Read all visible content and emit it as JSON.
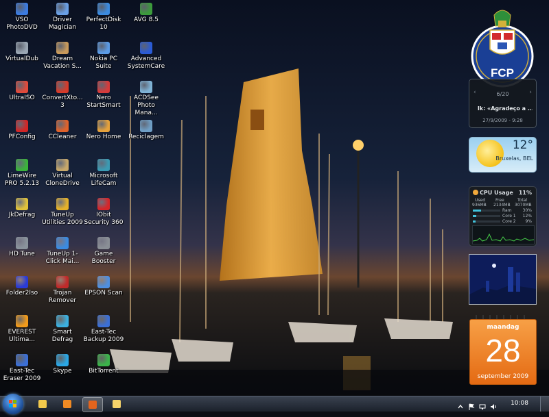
{
  "desktop": {
    "icons": [
      {
        "label": "VSO PhotoDVD",
        "icon": "vso-photodvd-icon",
        "color": "#3b7be0"
      },
      {
        "label": "VirtualDub",
        "icon": "virtualdub-icon",
        "color": "#9aa6b3"
      },
      {
        "label": "UltraISO",
        "icon": "ultraiso-icon",
        "color": "#e04a3b"
      },
      {
        "label": "PFConfig",
        "icon": "pfconfig-icon",
        "color": "#d22626"
      },
      {
        "label": "LimeWire PRO 5.2.13",
        "icon": "limewire-icon",
        "color": "#3bb33b"
      },
      {
        "label": "JkDefrag",
        "icon": "jkdefrag-icon",
        "color": "#e0c23b"
      },
      {
        "label": "HD Tune",
        "icon": "hdtune-icon",
        "color": "#8a939c"
      },
      {
        "label": "Folder2Iso",
        "icon": "folder2iso-icon",
        "color": "#2a3bd6"
      },
      {
        "label": "EVEREST Ultima...",
        "icon": "everest-icon",
        "color": "#f09a1b"
      },
      {
        "label": "East-Tec Eraser 2009",
        "icon": "east-tec-eraser-icon",
        "color": "#3b6fd6"
      },
      {
        "label": "Driver Magician",
        "icon": "driver-magician-icon",
        "color": "#6aa0e6"
      },
      {
        "label": "Dream Vacation S...",
        "icon": "dream-vacation-icon",
        "color": "#c99a5b"
      },
      {
        "label": "ConvertXto... 3",
        "icon": "convertxtodvd-icon",
        "color": "#d63b2a"
      },
      {
        "label": "CCleaner",
        "icon": "ccleaner-icon",
        "color": "#e0622a"
      },
      {
        "label": "Virtual CloneDrive",
        "icon": "virtual-clonedrive-icon",
        "color": "#c7a86a"
      },
      {
        "label": "TuneUp Utilities 2009",
        "icon": "tuneup-utilities-icon",
        "color": "#e6b22a"
      },
      {
        "label": "TuneUp 1-Click Mai...",
        "icon": "tuneup-1click-icon",
        "color": "#3b8be0"
      },
      {
        "label": "Trojan Remover",
        "icon": "trojan-remover-icon",
        "color": "#c02a2a"
      },
      {
        "label": "Smart Defrag",
        "icon": "smart-defrag-icon",
        "color": "#3bb0e0"
      },
      {
        "label": "Skype",
        "icon": "skype-icon",
        "color": "#2aa7e6"
      },
      {
        "label": "PerfectDisk 10",
        "icon": "perfectdisk-icon",
        "color": "#3b8be0"
      },
      {
        "label": "Nokia PC Suite",
        "icon": "nokia-pc-suite-icon",
        "color": "#5b9be6"
      },
      {
        "label": "Nero StartSmart",
        "icon": "nero-startsmart-icon",
        "color": "#d63b3b"
      },
      {
        "label": "Nero Home",
        "icon": "nero-home-icon",
        "color": "#e6a23b"
      },
      {
        "label": "Microsoft LifeCam",
        "icon": "lifecam-icon",
        "color": "#3b9bb3"
      },
      {
        "label": "IObit Security 360",
        "icon": "iobit-security-icon",
        "color": "#d6262a"
      },
      {
        "label": "Game Booster",
        "icon": "game-booster-icon",
        "color": "#8a8f96"
      },
      {
        "label": "EPSON Scan",
        "icon": "epson-scan-icon",
        "color": "#4f8fe0"
      },
      {
        "label": "East-Tec Backup 2009",
        "icon": "east-tec-backup-icon",
        "color": "#3b6fd6"
      },
      {
        "label": "BitTorrent",
        "icon": "bittorrent-icon",
        "color": "#3bb34a"
      },
      {
        "label": "AVG 8.5",
        "icon": "avg-icon",
        "color": "#3b9b3b"
      },
      {
        "label": "Advanced SystemCare",
        "icon": "advanced-systemcare-icon",
        "color": "#2a5bd6"
      },
      {
        "label": "ACDSee Photo Mana...",
        "icon": "acdsee-icon",
        "color": "#7fb3d6"
      },
      {
        "label": "Reciclagem",
        "icon": "recycle-bin-icon",
        "color": "#6f9fc6"
      }
    ]
  },
  "gadgets": {
    "logo": {
      "icon": "fc-porto-crest-icon",
      "text": "FCP"
    },
    "slideshow": {
      "counter": "6/20",
      "title": "lk: «Agradeço a ...",
      "datetime": "27/9/2009 - 9:28"
    },
    "weather": {
      "temperature": "12°",
      "location": "Bruxelas, BEL"
    },
    "cpu": {
      "title": "CPU Usage",
      "percent": "11%",
      "used_label": "Used",
      "free_label": "Free",
      "total_label": "Total",
      "used": "936MB",
      "free": "2134MB",
      "total": "3070MB",
      "rows": [
        {
          "label": "Ram",
          "value": "30%",
          "fill": 0.3
        },
        {
          "label": "Core 1",
          "value": "12%",
          "fill": 0.12
        },
        {
          "label": "Core 2",
          "value": "9%",
          "fill": 0.09
        }
      ]
    },
    "calendar": {
      "weekday": "maandag",
      "day": "28",
      "month_year": "september 2009"
    }
  },
  "taskbar": {
    "clock": "10:08",
    "buttons": [
      {
        "name": "explorer-taskbar-button",
        "icon": "folder-icon",
        "color": "#f2c94c"
      },
      {
        "name": "media-player-taskbar-button",
        "icon": "media-player-icon",
        "color": "#f08a24"
      },
      {
        "name": "firefox-taskbar-button",
        "icon": "firefox-icon",
        "color": "#e3641d"
      },
      {
        "name": "messenger-taskbar-button",
        "icon": "chat-icon",
        "color": "#f5d36b"
      }
    ]
  }
}
